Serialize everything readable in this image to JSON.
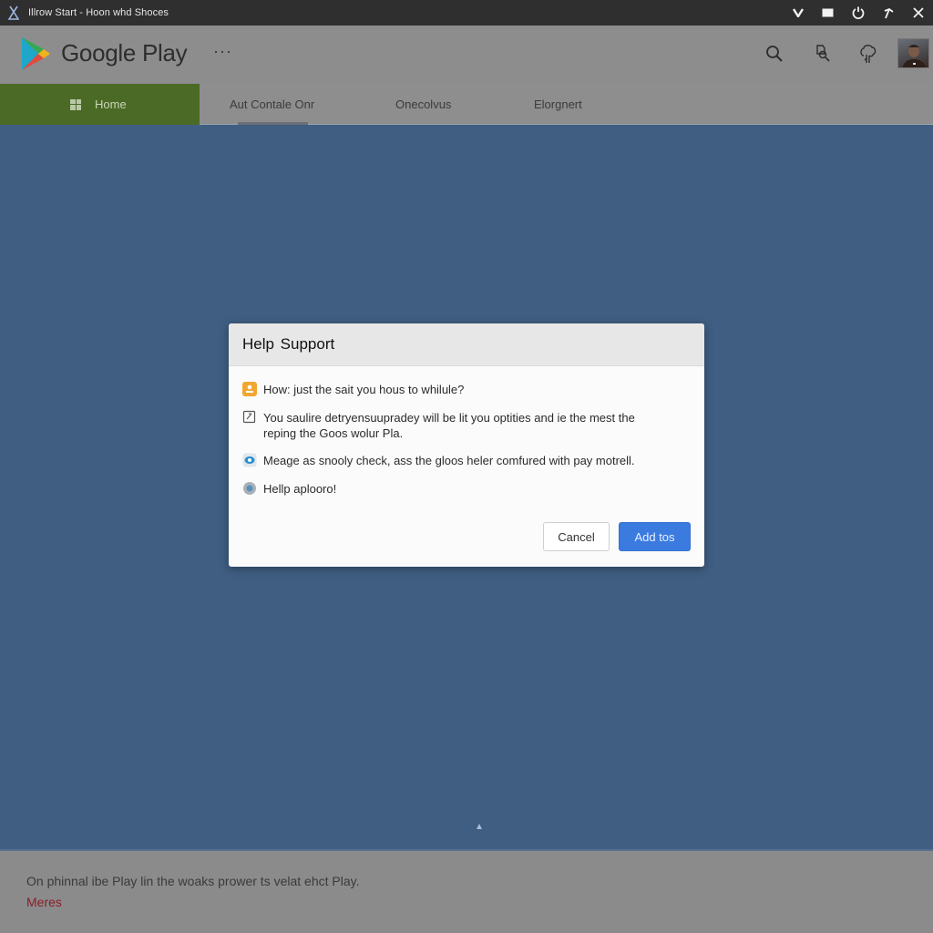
{
  "window": {
    "title": "Illrow Start - Hoon whd Shoces",
    "controls": [
      {
        "name": "chevron-down-icon",
        "glyph": "V"
      },
      {
        "name": "maximize-icon",
        "glyph": "■"
      },
      {
        "name": "power-icon",
        "glyph": "⏻"
      },
      {
        "name": "arrow-up-icon",
        "glyph": "↑"
      },
      {
        "name": "close-icon",
        "glyph": "✕"
      }
    ]
  },
  "header": {
    "brand": "Google Play",
    "more_label": "···",
    "icons": [
      "search-icon",
      "search-document-icon",
      "tree-icon"
    ],
    "logo_colors": {
      "blue": "#1ea7c8",
      "green": "#35a853",
      "red": "#e04a3f",
      "yellow": "#f2b41c"
    }
  },
  "nav": {
    "home_label": "Home",
    "tabs": [
      {
        "label": "Aut Contale Onr",
        "active": true
      },
      {
        "label": "Onecolvus",
        "active": false
      },
      {
        "label": "Elorgnert",
        "active": false
      }
    ]
  },
  "dialog": {
    "title": "Help Support",
    "items": [
      {
        "icon": "person-badge-icon",
        "text": "How: just the sait you hous to whilule?"
      },
      {
        "icon": "edit-box-icon",
        "text": "You saulire detryensuupradey will be lit you optities and ie the mest the reping the Goos wolur Pla."
      },
      {
        "icon": "eye-badge-icon",
        "text": "Meage as snooly check, ass the gloos heler comfured with pay motrell."
      },
      {
        "icon": "help-circle-icon",
        "text": "Hellp aplooro!"
      }
    ],
    "cancel_label": "Cancel",
    "confirm_label": "Add tos",
    "accent_color": "#3b7be0"
  },
  "footer": {
    "message": "On phinnal ibe Play lin the woaks prower ts velat ehct Play.",
    "link_label": "Meres"
  },
  "colors": {
    "titlebar": "#2f2f2f",
    "header": "#8d8d8d",
    "nav_home": "#4a6a26",
    "main_background": "#3f5e82",
    "footer": "#8b8b8b",
    "footer_link": "#8a1f2a"
  }
}
